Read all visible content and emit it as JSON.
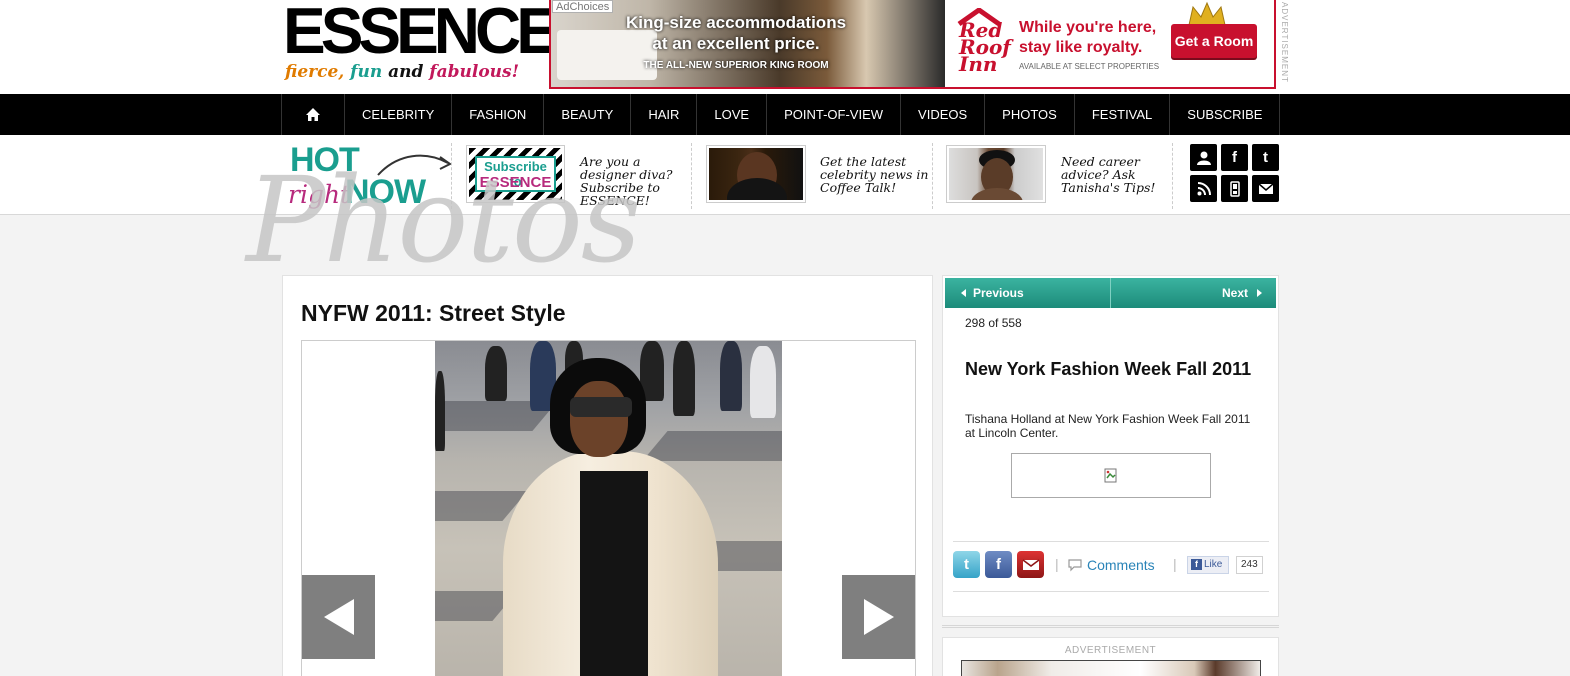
{
  "logo": {
    "wordmark": "ESSENCE",
    "tag_fierce": "fierce,",
    "tag_fun": "fun",
    "tag_and": "and",
    "tag_fabulous": "fabulous!"
  },
  "top_ad": {
    "adchoices": "AdChoices",
    "line1": "King-size accommodations at an excellent price.",
    "line3": "THE ALL-NEW SUPERIOR KING ROOM",
    "brand": "Red Roof Inn",
    "royal": "While you're here, stay like royalty.",
    "select": "AVAILABLE AT SELECT PROPERTIES",
    "cta": "Get a Room",
    "vertical_label": "ADVERTISEMENT"
  },
  "nav": {
    "items": [
      "CELEBRITY",
      "FASHION",
      "BEAUTY",
      "HAIR",
      "LOVE",
      "POINT-OF-VIEW",
      "VIDEOS",
      "PHOTOS",
      "FESTIVAL",
      "SUBSCRIBE"
    ]
  },
  "hot_now": {
    "hot": "HOT",
    "right": "right",
    "now": "NOW"
  },
  "promos": [
    {
      "badge_l1": "Subscribe to",
      "badge_l2": "ESSENCE",
      "text": "Are you a designer diva? Subscribe to ESSENCE!"
    },
    {
      "text": "Get the latest celebrity news in Coffee Talk!"
    },
    {
      "text": "Need career advice? Ask Tanisha's Tips!"
    }
  ],
  "section_watermark": "Photos",
  "gallery": {
    "title": "NYFW 2011: Street Style"
  },
  "sidebar": {
    "prev_label": "Previous",
    "next_label": "Next",
    "counter": "298 of 558",
    "title": "New York Fashion Week Fall 2011",
    "description": "Tishana Holland at New York Fashion Week Fall 2011 at Lincoln Center.",
    "comments": "Comments",
    "like": "Like",
    "like_count": "243"
  },
  "ad_panel": {
    "label": "ADVERTISEMENT"
  },
  "colors": {
    "teal": "#1a9e8f",
    "magenta": "#b72a7d",
    "red": "#c8102e",
    "nav_bg": "#000000"
  }
}
